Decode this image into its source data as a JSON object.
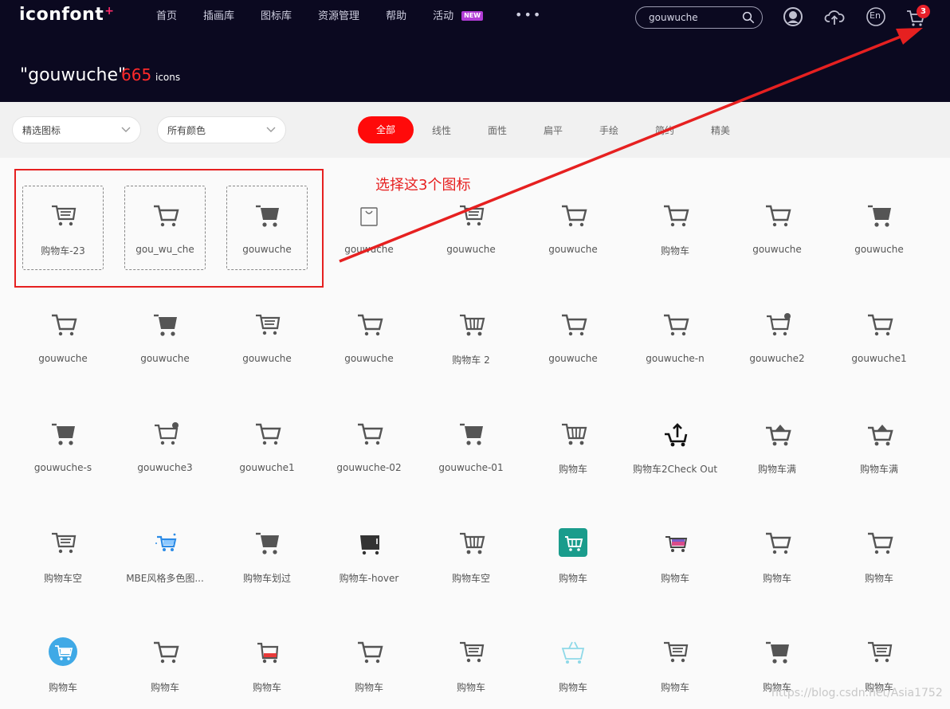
{
  "header": {
    "logo": "iconfont",
    "logo_plus": "+",
    "nav": [
      "首页",
      "插画库",
      "图标库",
      "资源管理",
      "帮助",
      "活动"
    ],
    "new_badge": "NEW",
    "search_value": "gouwuche",
    "cart_badge": "3",
    "lang_label": "En"
  },
  "result": {
    "query": "\"gouwuche\"",
    "count": "665",
    "unit": "icons"
  },
  "filters": {
    "select1": "精选图标",
    "select2": "所有颜色",
    "active": "全部",
    "tabs": [
      "线性",
      "面性",
      "扁平",
      "手绘",
      "简约",
      "精美"
    ]
  },
  "icons": [
    {
      "name": "购物车-23",
      "glyph": "cart-lines-icon",
      "selected": true
    },
    {
      "name": "gou_wu_che",
      "glyph": "cart-outline-icon",
      "selected": true
    },
    {
      "name": "gouwuche",
      "glyph": "cart-solid-icon",
      "selected": true
    },
    {
      "name": "gouwuche",
      "glyph": "bag-icon"
    },
    {
      "name": "gouwuche",
      "glyph": "cart-lines-icon"
    },
    {
      "name": "gouwuche",
      "glyph": "cart-outline-icon"
    },
    {
      "name": "购物车",
      "glyph": "cart-outline-icon"
    },
    {
      "name": "gouwuche",
      "glyph": "cart-outline-icon"
    },
    {
      "name": "gouwuche",
      "glyph": "cart-solid-icon"
    },
    {
      "name": "gouwuche",
      "glyph": "cart-outline-icon"
    },
    {
      "name": "gouwuche",
      "glyph": "cart-solid-icon"
    },
    {
      "name": "gouwuche",
      "glyph": "cart-lines-icon"
    },
    {
      "name": "gouwuche",
      "glyph": "cart-outline-icon"
    },
    {
      "name": "购物车 2",
      "glyph": "cart-grid-icon"
    },
    {
      "name": "gouwuche",
      "glyph": "cart-outline-icon"
    },
    {
      "name": "gouwuche-n",
      "glyph": "cart-outline-icon"
    },
    {
      "name": "gouwuche2",
      "glyph": "cart-dot-icon"
    },
    {
      "name": "gouwuche1",
      "glyph": "cart-outline-icon"
    },
    {
      "name": "gouwuche-s",
      "glyph": "cart-solid-icon"
    },
    {
      "name": "gouwuche3",
      "glyph": "cart-dot-icon"
    },
    {
      "name": "gouwuche1",
      "glyph": "cart-outline-icon"
    },
    {
      "name": "gouwuche-02",
      "glyph": "cart-outline-icon"
    },
    {
      "name": "gouwuche-01",
      "glyph": "cart-solid-icon"
    },
    {
      "name": "购物车",
      "glyph": "cart-grid-icon"
    },
    {
      "name": "购物车2Check Out",
      "glyph": "cart-checkout-icon"
    },
    {
      "name": "购物车满",
      "glyph": "cart-full-icon"
    },
    {
      "name": "购物车满",
      "glyph": "cart-full-icon"
    },
    {
      "name": "购物车空",
      "glyph": "cart-lines-icon"
    },
    {
      "name": "MBE风格多色图...",
      "glyph": "cart-blue-icon"
    },
    {
      "name": "购物车划过",
      "glyph": "cart-solid-icon"
    },
    {
      "name": "购物车-hover",
      "glyph": "cart-dark-icon"
    },
    {
      "name": "购物车空",
      "glyph": "cart-grid-icon"
    },
    {
      "name": "购物车",
      "glyph": "cart-teal-icon"
    },
    {
      "name": "购物车",
      "glyph": "cart-pink-icon"
    },
    {
      "name": "购物车",
      "glyph": "cart-outline-icon"
    },
    {
      "name": "购物车",
      "glyph": "cart-outline-icon"
    },
    {
      "name": "购物车",
      "glyph": "cart-circle-icon"
    },
    {
      "name": "购物车",
      "glyph": "cart-outline-icon"
    },
    {
      "name": "购物车",
      "glyph": "cart-red-icon"
    },
    {
      "name": "购物车",
      "glyph": "cart-outline-icon"
    },
    {
      "name": "购物车",
      "glyph": "cart-lines-icon"
    },
    {
      "name": "购物车",
      "glyph": "basket-light-icon"
    },
    {
      "name": "购物车",
      "glyph": "cart-lines-icon"
    },
    {
      "name": "购物车",
      "glyph": "cart-solid-icon"
    },
    {
      "name": "购物车",
      "glyph": "cart-lines-icon"
    }
  ],
  "annotation": {
    "text": "选择这3个图标",
    "color": "#e62020"
  },
  "watermark": "https://blog.csdn.net/Asia1752"
}
